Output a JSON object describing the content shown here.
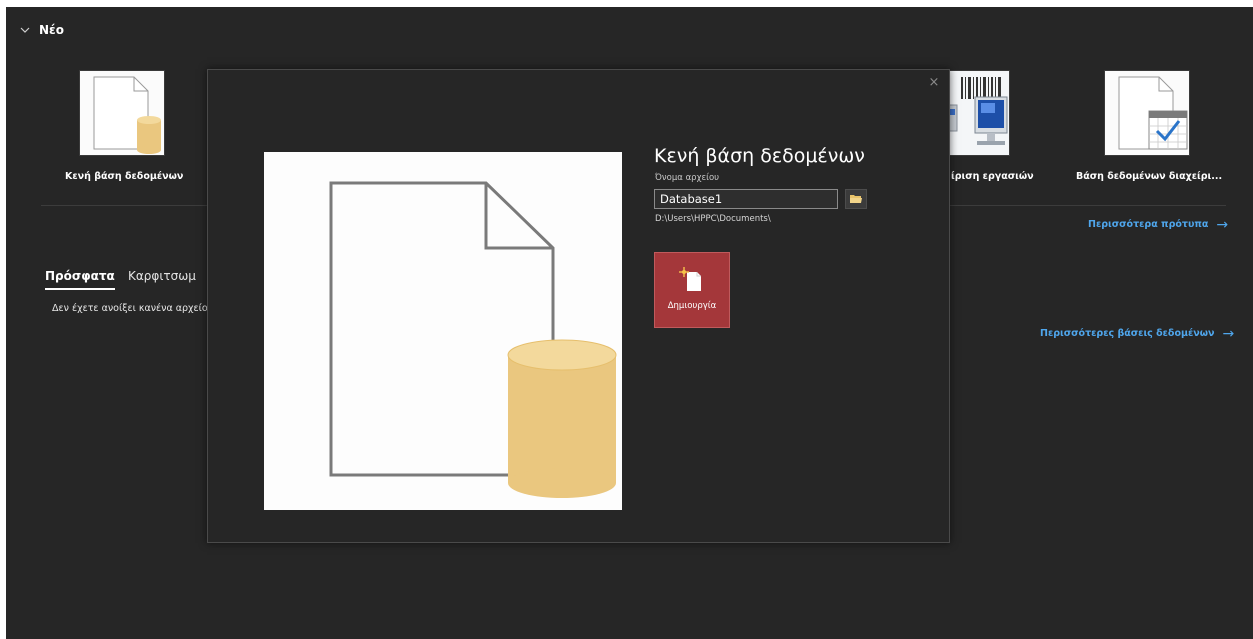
{
  "new_section": {
    "title": "Νέο",
    "templates": [
      {
        "label": "Κενή βάση δεδομένων"
      },
      {
        "label": "ίριση εργασιών"
      },
      {
        "label": "Βάση δεδομένων διαχείρι..."
      }
    ],
    "more_templates_link": "Περισσότερα πρότυπα",
    "more_databases_link": "Περισσότερες βάσεις δεδομένων"
  },
  "recent": {
    "tabs": [
      {
        "label": "Πρόσφατα",
        "active": true
      },
      {
        "label": "Καρφιτσωμ",
        "active": false
      }
    ],
    "empty_message": "Δεν έχετε ανοίξει κανένα αρχείο σ"
  },
  "dialog": {
    "title": "Κενή βάση δεδομένων",
    "file_name_label": "Όνομα αρχείου",
    "file_name_value": "Database1",
    "path": "D:\\Users\\HPPC\\Documents\\",
    "create_button_label": "Δημιουργία",
    "close_glyph": "×"
  },
  "colors": {
    "background": "#262626",
    "link": "#4fa6ec",
    "create_button": "#a4373a",
    "database_cylinder": "#eac77f"
  },
  "icons": [
    "chevron-down-icon",
    "close-icon",
    "folder-icon",
    "new-database-icon",
    "arrow-right-icon"
  ]
}
